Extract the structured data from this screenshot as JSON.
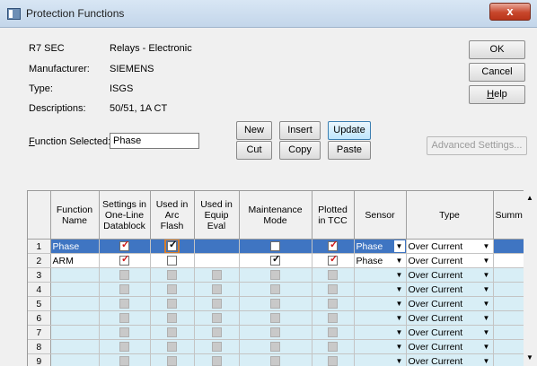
{
  "window": {
    "title": "Protection Functions",
    "close_glyph": "x"
  },
  "device": {
    "id": "R7 SEC",
    "category": "Relays - Electronic",
    "manufacturer_label": "Manufacturer:",
    "manufacturer": "SIEMENS",
    "type_label": "Type:",
    "type": "ISGS",
    "descriptions_label": "Descriptions:",
    "descriptions": "50/51, 1A CT"
  },
  "function_selected": {
    "label_prefix": "F",
    "label_rest": "unction Selected:",
    "value": "Phase"
  },
  "buttons": {
    "ok": "OK",
    "cancel": "Cancel",
    "help_u": "H",
    "help_rest": "elp",
    "new": "New",
    "insert": "Insert",
    "update": "Update",
    "cut": "Cut",
    "copy": "Copy",
    "paste": "Paste",
    "advanced": "Advanced Settings..."
  },
  "table": {
    "headers": {
      "function_name": "Function Name",
      "settings": "Settings in One-Line Datablock",
      "arc_flash": "Used in Arc Flash",
      "equip_eval": "Used in Equip Eval",
      "maintenance": "Maintenance Mode",
      "plotted": "Plotted in TCC",
      "sensor": "Sensor",
      "type": "Type",
      "summary": "Summ"
    },
    "rows": [
      {
        "n": "1",
        "name": "Phase",
        "sensor": "Phase",
        "type": "Over Current"
      },
      {
        "n": "2",
        "name": "ARM",
        "sensor": "Phase",
        "type": "Over Current"
      },
      {
        "n": "3",
        "name": "",
        "sensor": "",
        "type": "Over Current"
      },
      {
        "n": "4",
        "name": "",
        "sensor": "",
        "type": "Over Current"
      },
      {
        "n": "5",
        "name": "",
        "sensor": "",
        "type": "Over Current"
      },
      {
        "n": "6",
        "name": "",
        "sensor": "",
        "type": "Over Current"
      },
      {
        "n": "7",
        "name": "",
        "sensor": "",
        "type": "Over Current"
      },
      {
        "n": "8",
        "name": "",
        "sensor": "",
        "type": "Over Current"
      },
      {
        "n": "9",
        "name": "",
        "sensor": "",
        "type": "Over Current"
      }
    ]
  },
  "colors": {
    "selected_row": "#3f75c2",
    "empty_row": "#d8eef6",
    "focus_outline": "#d67d2c",
    "red_check": "#d01818"
  }
}
